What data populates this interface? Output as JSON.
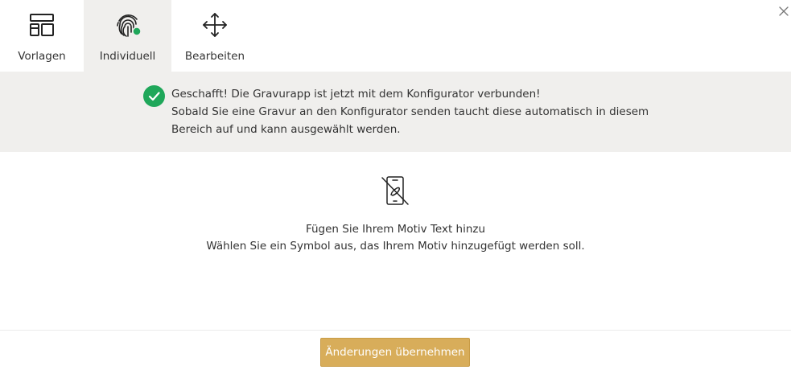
{
  "tabs": [
    {
      "label": "Vorlagen",
      "icon": "layout-template-icon",
      "active": false
    },
    {
      "label": "Individuell",
      "icon": "fingerprint-icon",
      "active": true
    },
    {
      "label": "Bearbeiten",
      "icon": "move-arrows-icon",
      "active": false
    }
  ],
  "close": {
    "icon": "close-icon"
  },
  "banner": {
    "icon": "check-circle-icon",
    "line1": "Geschafft! Die Gravurapp ist jetzt mit dem Konfigurator verbunden!",
    "line2": "Sobald Sie eine Gravur an den Konfigurator senden taucht diese automatisch in diesem",
    "line3": "Bereich auf und kann ausgewählt werden."
  },
  "empty_state": {
    "icon": "no-phone-icon",
    "line1": "Fügen Sie Ihrem Motiv Text hinzu",
    "line2": "Wählen Sie ein Symbol aus, das Ihrem Motiv hinzugefügt werden soll."
  },
  "footer": {
    "apply_label": "Änderungen übernehmen"
  },
  "colors": {
    "accent": "#d8ad5a",
    "success": "#1fa75a",
    "panel_bg": "#f0efed",
    "text": "#333333"
  }
}
